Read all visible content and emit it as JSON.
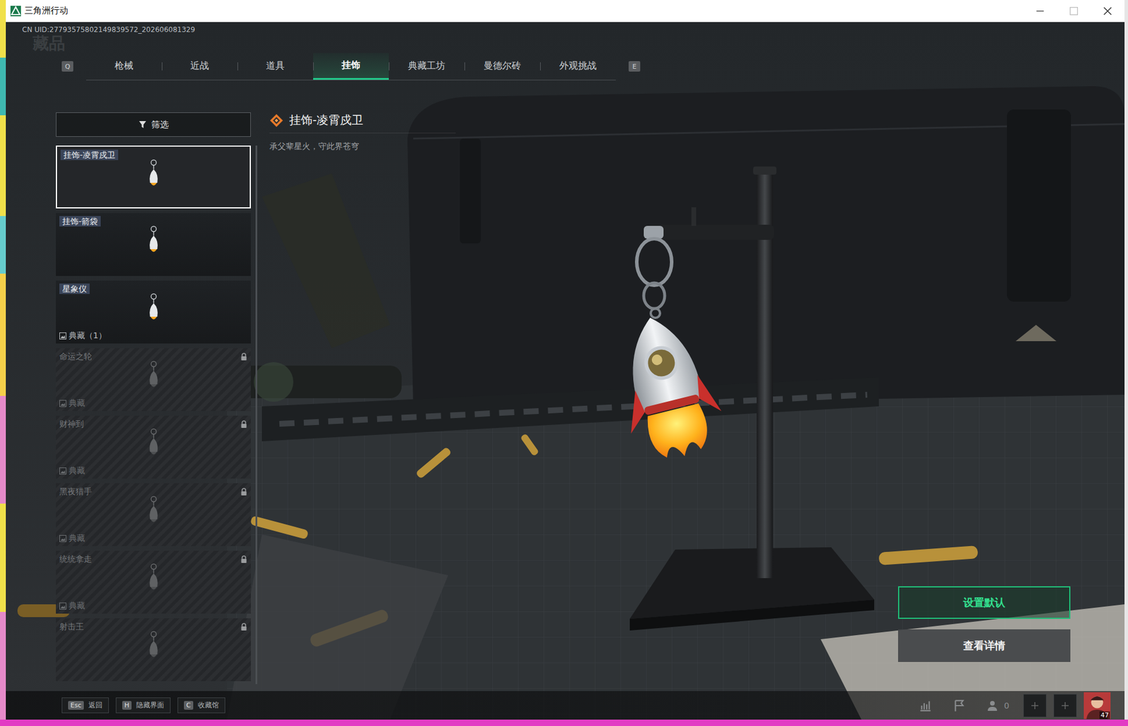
{
  "window": {
    "title": "三角洲行动"
  },
  "uid": "CN UID:27793575802149839572_202606081329",
  "watermark": "藏品",
  "tabs": {
    "prev_key": "Q",
    "next_key": "E",
    "items": [
      {
        "label": "枪械",
        "selected": false
      },
      {
        "label": "近战",
        "selected": false
      },
      {
        "label": "道具",
        "selected": false
      },
      {
        "label": "挂饰",
        "selected": true
      },
      {
        "label": "典藏工坊",
        "selected": false
      },
      {
        "label": "曼德尔砖",
        "selected": false
      },
      {
        "label": "外观挑战",
        "selected": false
      }
    ]
  },
  "filter": {
    "label": "筛选"
  },
  "items": [
    {
      "name": "挂饰-凌霄戍卫",
      "selected": true,
      "locked": false,
      "tag": ""
    },
    {
      "name": "挂饰-箭袋",
      "selected": false,
      "locked": false,
      "tag": ""
    },
    {
      "name": "星象仪",
      "selected": false,
      "locked": false,
      "tag": "典藏（1）"
    },
    {
      "name": "命运之轮",
      "selected": false,
      "locked": true,
      "tag": "典藏"
    },
    {
      "name": "财神到",
      "selected": false,
      "locked": true,
      "tag": "典藏"
    },
    {
      "name": "黑夜猎手",
      "selected": false,
      "locked": true,
      "tag": "典藏"
    },
    {
      "name": "统统拿走",
      "selected": false,
      "locked": true,
      "tag": "典藏"
    },
    {
      "name": "射击王",
      "selected": false,
      "locked": true,
      "tag": ""
    }
  ],
  "detail": {
    "title": "挂饰-凌霄戍卫",
    "description": "承父辈星火，守此界苍穹"
  },
  "actions": [
    {
      "label": "设置默认",
      "primary": true
    },
    {
      "label": "查看详情",
      "primary": false
    }
  ],
  "hints": [
    {
      "key": "Esc",
      "label": "返回"
    },
    {
      "key": "H",
      "label": "隐藏界面"
    },
    {
      "key": "C",
      "label": "收藏馆"
    }
  ],
  "status": {
    "friends": "0",
    "level": "47"
  }
}
